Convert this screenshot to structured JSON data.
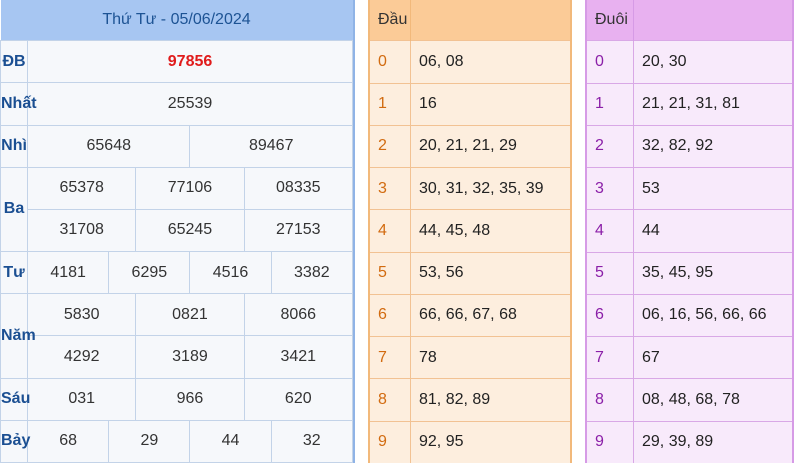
{
  "results": {
    "title": "Thứ Tư - 05/06/2024",
    "db_label": "ĐB",
    "db": "97856",
    "nhat_label": "Nhất",
    "nhat": "25539",
    "nhi_label": "Nhì",
    "nhi": [
      "65648",
      "89467"
    ],
    "ba_label": "Ba",
    "ba": [
      "65378",
      "77106",
      "08335",
      "31708",
      "65245",
      "27153"
    ],
    "tu_label": "Tư",
    "tu": [
      "4181",
      "6295",
      "4516",
      "3382"
    ],
    "nam_label": "Năm",
    "nam": [
      "5830",
      "0821",
      "8066",
      "4292",
      "3189",
      "3421"
    ],
    "sau_label": "Sáu",
    "sau": [
      "031",
      "966",
      "620"
    ],
    "bay_label": "Bảy",
    "bay": [
      "68",
      "29",
      "44",
      "32"
    ]
  },
  "dau": {
    "header": "Đầu",
    "rows": [
      {
        "k": "0",
        "v": "06, 08"
      },
      {
        "k": "1",
        "v": "16"
      },
      {
        "k": "2",
        "v": "20, 21, 21, 29"
      },
      {
        "k": "3",
        "v": "30, 31, 32, 35, 39"
      },
      {
        "k": "4",
        "v": "44, 45, 48"
      },
      {
        "k": "5",
        "v": "53, 56"
      },
      {
        "k": "6",
        "v": "66, 66, 67, 68"
      },
      {
        "k": "7",
        "v": "78"
      },
      {
        "k": "8",
        "v": "81, 82, 89"
      },
      {
        "k": "9",
        "v": "92, 95"
      }
    ]
  },
  "duoi": {
    "header": "Đuôi",
    "rows": [
      {
        "k": "0",
        "v": "20, 30"
      },
      {
        "k": "1",
        "v": "21, 21, 31, 81"
      },
      {
        "k": "2",
        "v": "32, 82, 92"
      },
      {
        "k": "3",
        "v": "53"
      },
      {
        "k": "4",
        "v": "44"
      },
      {
        "k": "5",
        "v": "35, 45, 95"
      },
      {
        "k": "6",
        "v": "06, 16, 56, 66, 66"
      },
      {
        "k": "7",
        "v": "67"
      },
      {
        "k": "8",
        "v": "08, 48, 68, 78"
      },
      {
        "k": "9",
        "v": "29, 39, 89"
      }
    ]
  }
}
